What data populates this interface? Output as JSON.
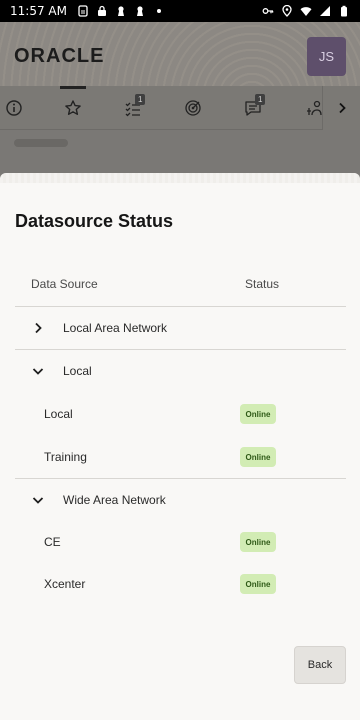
{
  "status_bar": {
    "time": "11:57 AM",
    "left_icons": [
      "sim-icon",
      "lock-icon",
      "keyhole-icon",
      "keyhole-icon",
      "dot-icon"
    ],
    "right_icons": [
      "key-icon",
      "location-icon",
      "wifi-icon",
      "signal-icon",
      "battery-icon"
    ]
  },
  "app": {
    "logo": "ORACLE",
    "avatar_initials": "JS",
    "tabs": [
      {
        "icon": "info-icon",
        "badge": ""
      },
      {
        "icon": "star-icon",
        "badge": ""
      },
      {
        "icon": "checklist-icon",
        "badge": "1"
      },
      {
        "icon": "target-icon",
        "badge": ""
      },
      {
        "icon": "chat-icon",
        "badge": "1"
      },
      {
        "icon": "people-icon",
        "badge": ""
      }
    ],
    "tab_scroll_icon": "chevron-right-icon"
  },
  "sheet": {
    "title": "Datasource Status",
    "columns": {
      "data_source": "Data Source",
      "status": "Status"
    },
    "groups": [
      {
        "name": "Local Area Network",
        "expanded": false,
        "items": []
      },
      {
        "name": "Local",
        "expanded": true,
        "items": [
          {
            "name": "Local",
            "status": "Online"
          },
          {
            "name": "Training",
            "status": "Online"
          }
        ]
      },
      {
        "name": "Wide Area Network",
        "expanded": true,
        "items": [
          {
            "name": "CE",
            "status": "Online"
          },
          {
            "name": "Xcenter",
            "status": "Online"
          }
        ]
      }
    ],
    "back_label": "Back"
  },
  "colors": {
    "online_bg": "#d2ecb4",
    "online_text": "#2f5a17",
    "avatar_bg": "#5e4f6b",
    "sheet_bg": "#f9f8f6"
  }
}
